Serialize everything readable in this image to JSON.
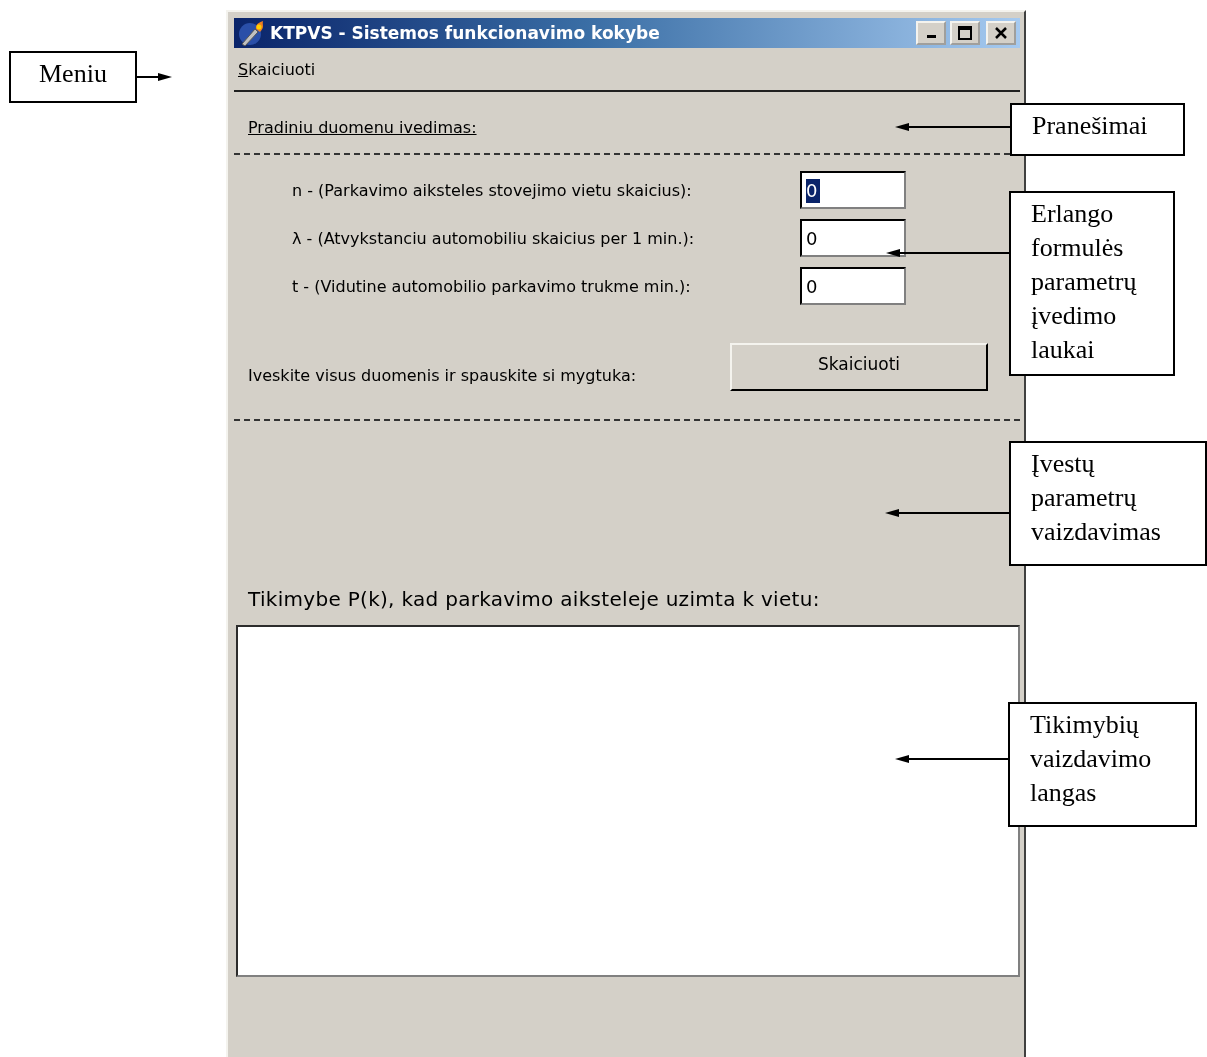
{
  "window": {
    "title": "KTPVS - Sistemos funkcionavimo kokybe"
  },
  "menu": [
    {
      "label": "Skaiciuoti"
    }
  ],
  "section_heading": "Pradiniu duomenu ivedimas:",
  "fields": [
    {
      "label": "n - (Parkavimo aiksteles stovejimo vietu skaicius):",
      "value": "0",
      "focused": true
    },
    {
      "label": "λ - (Atvykstanciu automobiliu skaicius per 1 min.):",
      "value": "0",
      "focused": false
    },
    {
      "label": "t - (Vidutine automobilio parkavimo trukme min.):",
      "value": "0",
      "focused": false
    }
  ],
  "prompt": "Iveskite visus duomenis ir spauskite si mygtuka:",
  "button": "Skaiciuoti",
  "probability_label": "Tikimybe P(k), kad parkavimo aiksteleje uzimta k vietu:",
  "annotations": [
    {
      "text": "Meniu"
    },
    {
      "text": "Pranešimai"
    },
    {
      "text": "Erlango formulės parametrų įvedimo laukai"
    },
    {
      "text": "Įvestų parametrų vaizdavimas"
    },
    {
      "text": "Tikimybių vaizdavimo langas"
    }
  ]
}
